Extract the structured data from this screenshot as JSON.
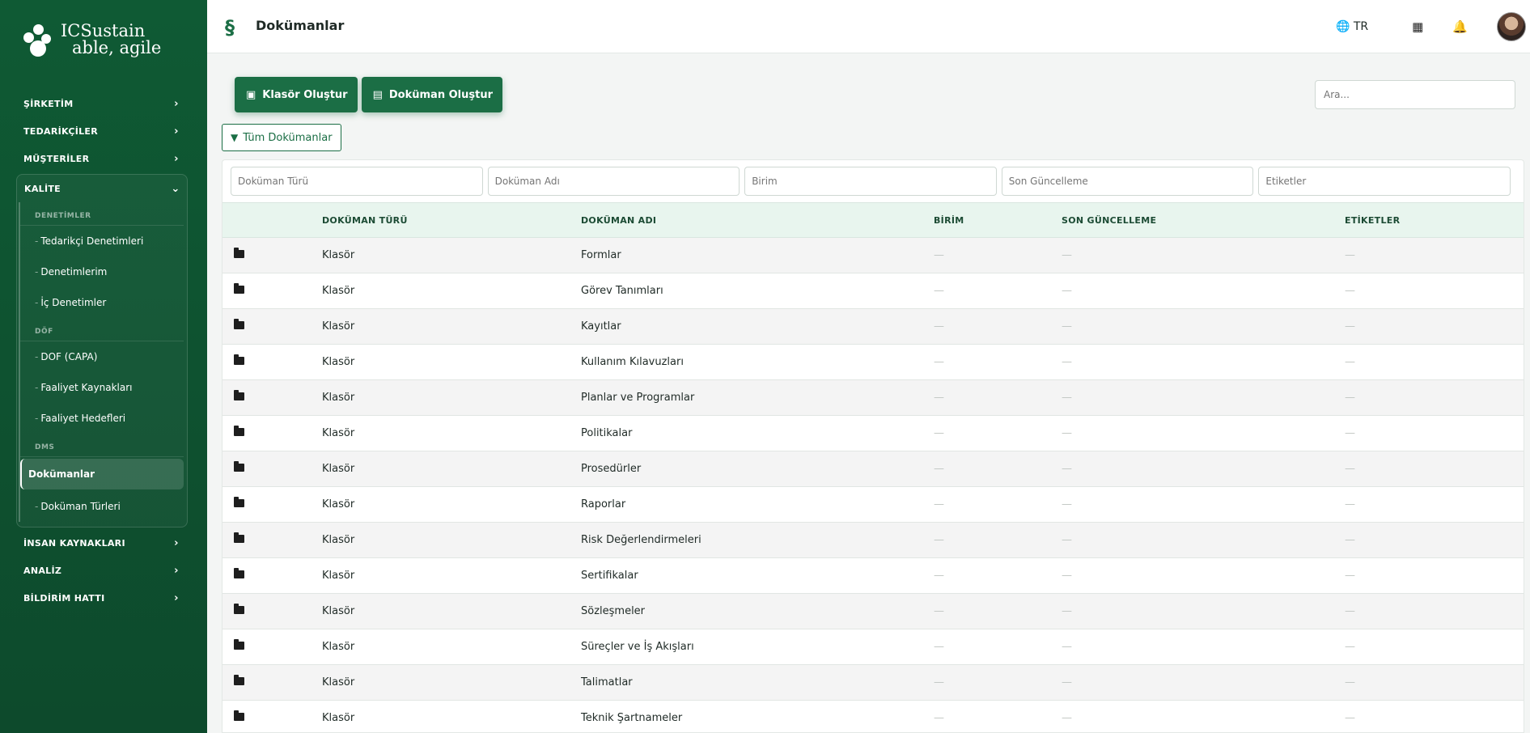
{
  "sidebar": {
    "logo": {
      "line1": "ICSustain",
      "line2": "able, agile"
    },
    "items_top": [
      {
        "label": "ŞİRKETİM"
      },
      {
        "label": "TEDARİKÇİLER"
      },
      {
        "label": "MÜŞTERİLER"
      }
    ],
    "kalite": {
      "label": "KALİTE",
      "groups": [
        {
          "title": "DENETİMLER",
          "items": [
            "Tedarikçi Denetimleri",
            "Denetimlerim",
            "İç Denetimler"
          ]
        },
        {
          "title": "DÖF",
          "items": [
            "DOF (CAPA)",
            "Faaliyet Kaynakları",
            "Faaliyet Hedefleri"
          ]
        },
        {
          "title": "DMS",
          "items": [
            "Dokümanlar",
            "Doküman Türleri"
          ],
          "active": "Dokümanlar"
        }
      ]
    },
    "items_bottom": [
      {
        "label": "İNSAN KAYNAKLARI"
      },
      {
        "label": "ANALİZ"
      },
      {
        "label": "BİLDİRİM HATTI"
      }
    ]
  },
  "topbar": {
    "title": "Dokümanlar",
    "language": "TR"
  },
  "toolbar": {
    "create_folder": "Klasör Oluştur",
    "create_document": "Doküman Oluştur",
    "search_placeholder": "Ara...",
    "filter_label": "Tüm Dokümanlar"
  },
  "table": {
    "filter_placeholders": [
      "Doküman Türü",
      "Doküman Adı",
      "Birim",
      "Son Güncelleme",
      "Etiketler"
    ],
    "columns": [
      "",
      "DOKÜMAN TÜRÜ",
      "DOKÜMAN ADI",
      "BİRİM",
      "SON GÜNCELLEME",
      "ETİKETLER"
    ],
    "empty_value": "—",
    "rows": [
      {
        "type": "Klasör",
        "name": "Formlar"
      },
      {
        "type": "Klasör",
        "name": "Görev Tanımları"
      },
      {
        "type": "Klasör",
        "name": "Kayıtlar"
      },
      {
        "type": "Klasör",
        "name": "Kullanım Kılavuzları"
      },
      {
        "type": "Klasör",
        "name": "Planlar ve Programlar"
      },
      {
        "type": "Klasör",
        "name": "Politikalar"
      },
      {
        "type": "Klasör",
        "name": "Prosedürler"
      },
      {
        "type": "Klasör",
        "name": "Raporlar"
      },
      {
        "type": "Klasör",
        "name": "Risk Değerlendirmeleri"
      },
      {
        "type": "Klasör",
        "name": "Sertifikalar"
      },
      {
        "type": "Klasör",
        "name": "Sözleşmeler"
      },
      {
        "type": "Klasör",
        "name": "Süreçler ve İş Akışları"
      },
      {
        "type": "Klasör",
        "name": "Talimatlar"
      },
      {
        "type": "Klasör",
        "name": "Teknik Şartnameler"
      }
    ]
  }
}
